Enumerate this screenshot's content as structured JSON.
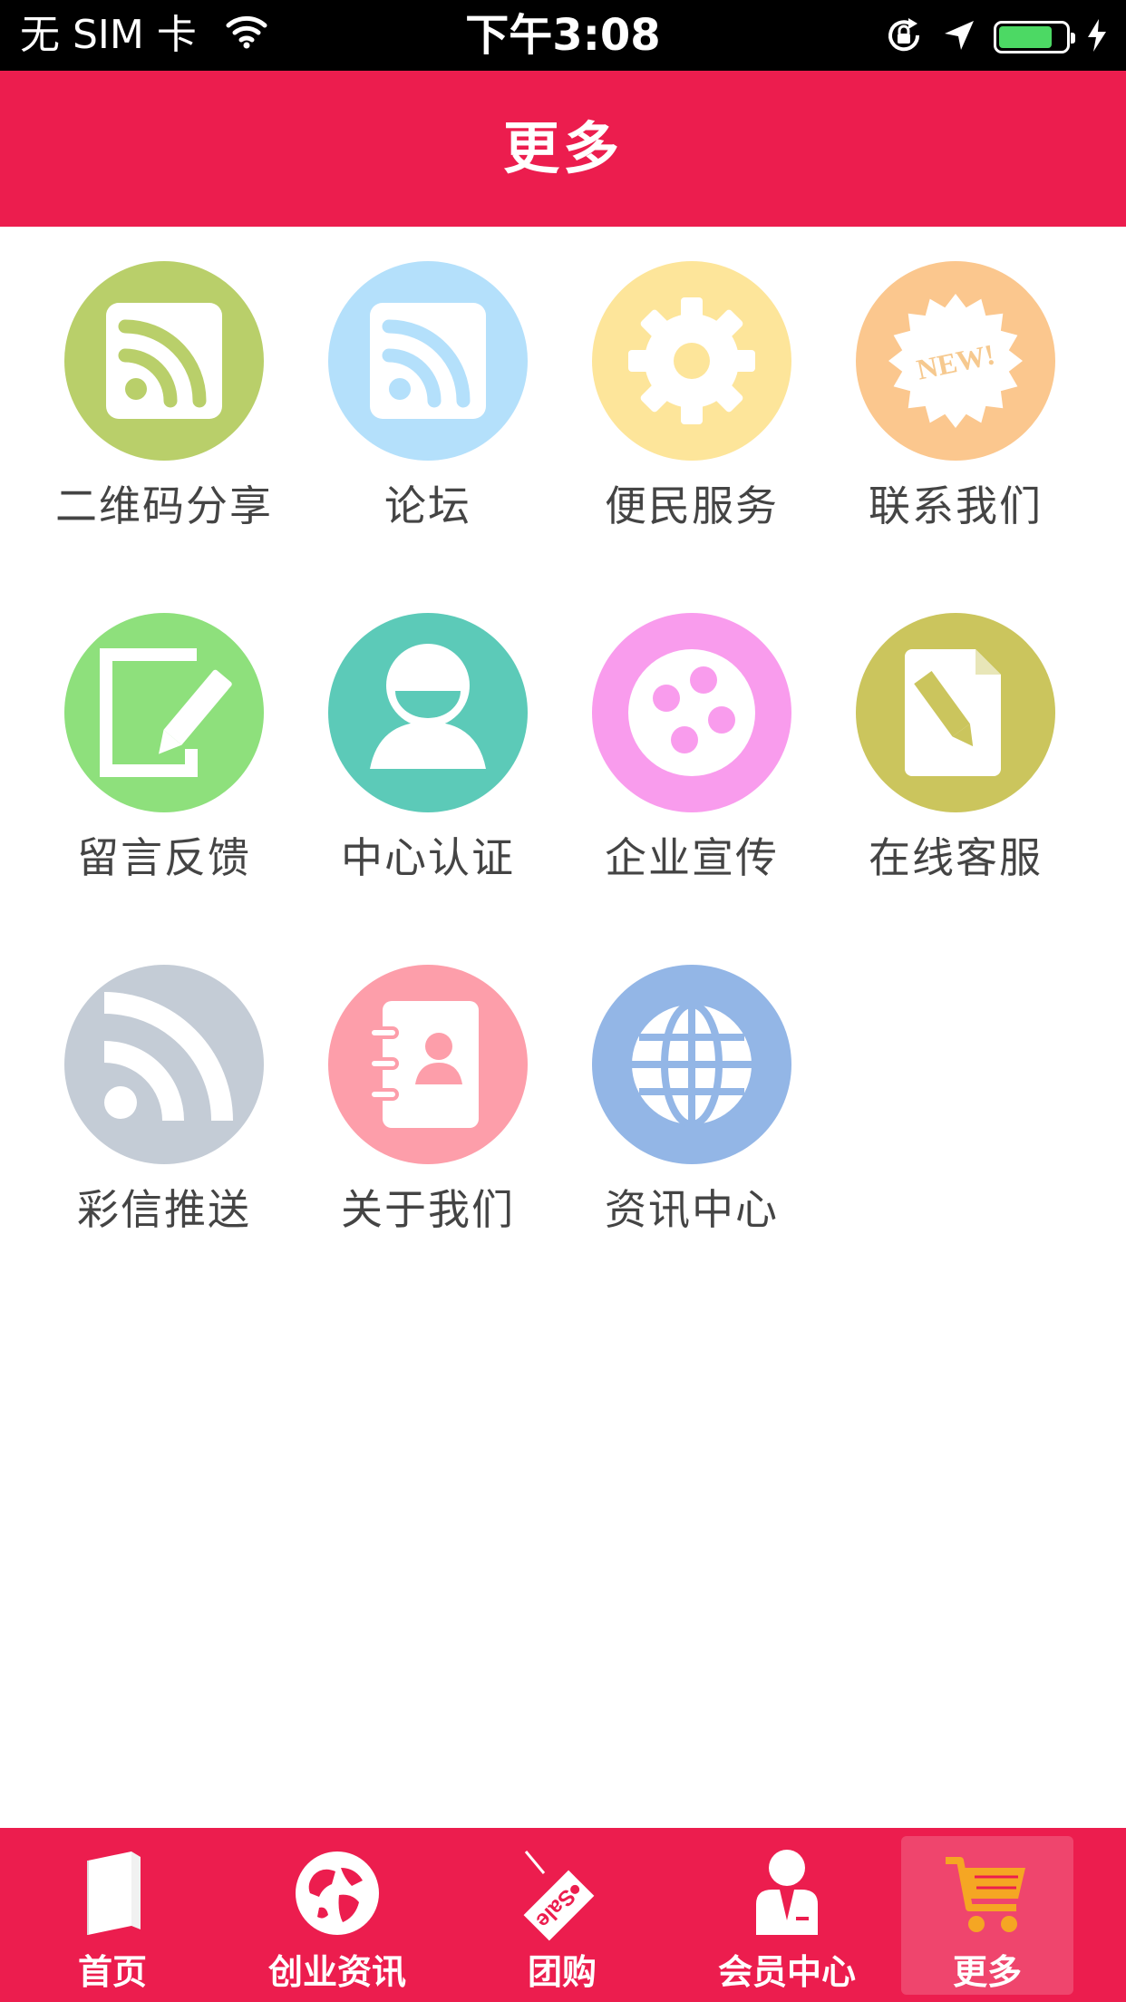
{
  "status_bar": {
    "carrier": "无 SIM 卡",
    "time": "下午3:08",
    "battery_level": 0.8
  },
  "header": {
    "title": "更多"
  },
  "grid": {
    "items": [
      {
        "label": "二维码分享",
        "icon": "rss-square-icon",
        "color": "#b9cf6a"
      },
      {
        "label": "论坛",
        "icon": "rss-square-icon",
        "color": "#b4e0fb"
      },
      {
        "label": "便民服务",
        "icon": "gear-icon",
        "color": "#fde59a"
      },
      {
        "label": "联系我们",
        "icon": "new-badge-icon",
        "badge_text": "NEW!",
        "color": "#fbc78e"
      },
      {
        "label": "留言反馈",
        "icon": "edit-icon",
        "color": "#8ee07c"
      },
      {
        "label": "中心认证",
        "icon": "user-icon",
        "color": "#5ccab8"
      },
      {
        "label": "企业宣传",
        "icon": "film-reel-icon",
        "color": "#f99ced"
      },
      {
        "label": "在线客服",
        "icon": "document-pencil-icon",
        "color": "#cbc55d"
      },
      {
        "label": "彩信推送",
        "icon": "rss-icon",
        "color": "#c4ccd6"
      },
      {
        "label": "关于我们",
        "icon": "address-book-icon",
        "color": "#fd9eaa"
      },
      {
        "label": "资讯中心",
        "icon": "globe-icon",
        "color": "#93b6e6"
      }
    ]
  },
  "tabbar": {
    "items": [
      {
        "label": "首页",
        "icon": "book-icon",
        "active": false
      },
      {
        "label": "创业资讯",
        "icon": "globe-icon",
        "active": false
      },
      {
        "label": "团购",
        "icon": "sale-tag-icon",
        "tag_text": "Sale",
        "active": false
      },
      {
        "label": "会员中心",
        "icon": "member-icon",
        "active": false
      },
      {
        "label": "更多",
        "icon": "cart-icon",
        "active": true
      }
    ]
  },
  "colors": {
    "accent": "#ec1d4e",
    "label_text": "#444444",
    "cart_icon": "#f5a623"
  }
}
